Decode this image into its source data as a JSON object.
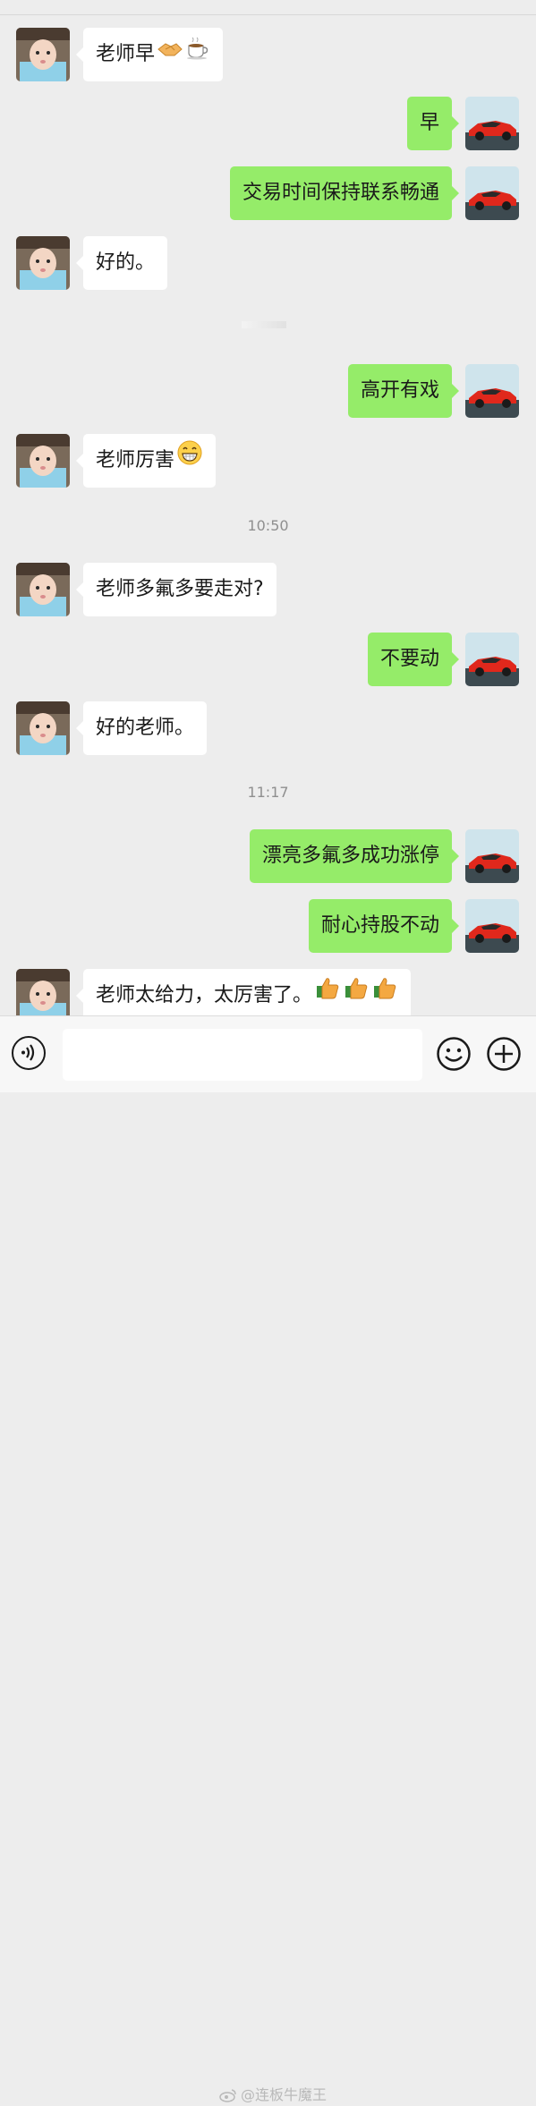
{
  "colors": {
    "sent_bubble": "#95ec69",
    "received_bubble": "#ffffff",
    "background": "#ededed",
    "timestamp": "#8f8f8f"
  },
  "messages": [
    {
      "side": "left",
      "text": "老师早",
      "emojis": [
        "handshake-icon",
        "coffee-icon"
      ]
    },
    {
      "side": "right",
      "text": "早"
    },
    {
      "side": "right",
      "text": "交易时间保持联系畅通"
    },
    {
      "side": "left",
      "text": "好的。"
    },
    {
      "side": "right",
      "text": "高开有戏"
    },
    {
      "side": "left",
      "text": "老师厉害",
      "emojis": [
        "grin-icon"
      ]
    },
    {
      "type": "time",
      "text": "10:50"
    },
    {
      "side": "left",
      "text": "老师多氟多要走对?"
    },
    {
      "side": "right",
      "text": "不要动"
    },
    {
      "side": "left",
      "text": "好的老师。"
    },
    {
      "type": "time",
      "text": "11:17"
    },
    {
      "side": "right",
      "text": "漂亮多氟多成功涨停"
    },
    {
      "side": "right",
      "text": "耐心持股不动"
    },
    {
      "side": "left",
      "text": "老师太给力，太厉害了。",
      "emojis": [
        "thumbs-up-icon",
        "thumbs-up-icon",
        "thumbs-up-icon"
      ]
    }
  ],
  "input_bar": {
    "voice_icon": "voice-icon",
    "emoji_icon": "smiley-icon",
    "plus_icon": "plus-icon"
  },
  "watermark": {
    "text": "@连板牛魔王"
  }
}
